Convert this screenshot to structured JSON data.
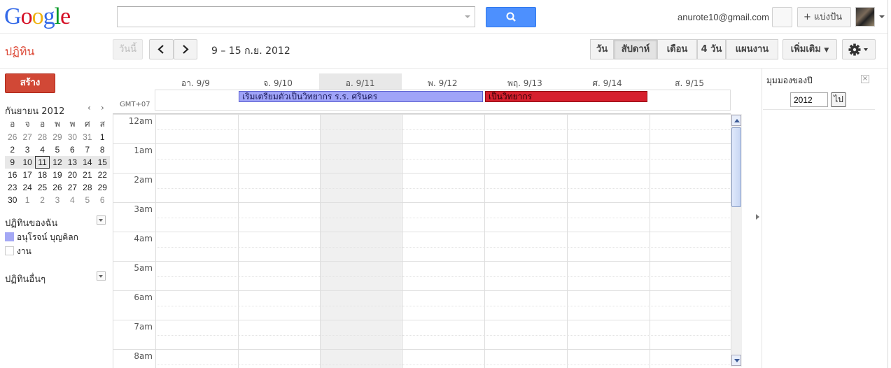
{
  "logo": {
    "letters": [
      {
        "ch": "G",
        "color": "#3369e8"
      },
      {
        "ch": "o",
        "color": "#d50f25"
      },
      {
        "ch": "o",
        "color": "#eeb211"
      },
      {
        "ch": "g",
        "color": "#3369e8"
      },
      {
        "ch": "l",
        "color": "#009925"
      },
      {
        "ch": "e",
        "color": "#d50f25"
      }
    ]
  },
  "header": {
    "email": "anurote10@gmail.com",
    "share_label": "+ แบ่งปัน"
  },
  "toolbar": {
    "title": "ปฏิทิน",
    "today_label": "วันนี้",
    "date_range": "9 – 15 ก.ย. 2012",
    "views": [
      {
        "label": "วัน",
        "active": false
      },
      {
        "label": "สัปดาห์",
        "active": true
      },
      {
        "label": "เดือน",
        "active": false
      },
      {
        "label": "4 วัน",
        "active": false
      },
      {
        "label": "แผนงาน",
        "active": false
      }
    ],
    "more_label": "เพิ่มเติม"
  },
  "sidebar": {
    "create_label": "สร้าง",
    "mini_calendar": {
      "month_label": "กันยายน 2012",
      "weekdays": [
        "อ",
        "จ",
        "อ",
        "พ",
        "พ",
        "ศ",
        "ส"
      ],
      "weeks": [
        [
          {
            "d": "26",
            "o": true
          },
          {
            "d": "27",
            "o": true
          },
          {
            "d": "28",
            "o": true
          },
          {
            "d": "29",
            "o": true
          },
          {
            "d": "30",
            "o": true
          },
          {
            "d": "31",
            "o": true
          },
          {
            "d": "1"
          }
        ],
        [
          {
            "d": "2"
          },
          {
            "d": "3"
          },
          {
            "d": "4"
          },
          {
            "d": "5"
          },
          {
            "d": "6"
          },
          {
            "d": "7"
          },
          {
            "d": "8"
          }
        ],
        [
          {
            "d": "9"
          },
          {
            "d": "10"
          },
          {
            "d": "11",
            "today": true
          },
          {
            "d": "12"
          },
          {
            "d": "13"
          },
          {
            "d": "14"
          },
          {
            "d": "15"
          }
        ],
        [
          {
            "d": "16"
          },
          {
            "d": "17"
          },
          {
            "d": "18"
          },
          {
            "d": "19"
          },
          {
            "d": "20"
          },
          {
            "d": "21"
          },
          {
            "d": "22"
          }
        ],
        [
          {
            "d": "23"
          },
          {
            "d": "24"
          },
          {
            "d": "25"
          },
          {
            "d": "26"
          },
          {
            "d": "27"
          },
          {
            "d": "28"
          },
          {
            "d": "29"
          }
        ],
        [
          {
            "d": "30"
          },
          {
            "d": "1",
            "o": true
          },
          {
            "d": "2",
            "o": true
          },
          {
            "d": "3",
            "o": true
          },
          {
            "d": "4",
            "o": true
          },
          {
            "d": "5",
            "o": true
          },
          {
            "d": "6",
            "o": true
          }
        ]
      ],
      "selected_week_index": 2
    },
    "my_calendars_title": "ปฏิทินของฉัน",
    "my_calendars": [
      {
        "name": "อนุโรจน์ บุญคิลก",
        "color": "#a4a8f5",
        "checked": true
      },
      {
        "name": "งาน",
        "color": "#ffffff",
        "checked": false
      }
    ],
    "other_calendars_title": "ปฏิทินอื่นๆ"
  },
  "grid": {
    "timezone": "GMT+07",
    "days": [
      "อา. 9/9",
      "จ. 9/10",
      "อ. 9/11",
      "พ. 9/12",
      "พฤ. 9/13",
      "ศ. 9/14",
      "ส. 9/15"
    ],
    "today_index": 2,
    "hours": [
      "12am",
      "1am",
      "2am",
      "3am",
      "4am",
      "5am",
      "6am",
      "7am",
      "8am"
    ],
    "allday_events": [
      {
        "title": "เริ่มเตรียมตัวเป็นวิทยากร ร.ร. ศรินคร",
        "bg": "#a0a4f8",
        "border": "#5a5fcf",
        "text": "#1a1a5a"
      },
      {
        "title": "เป็นวิทยากร",
        "bg": "#d6202e",
        "border": "#8e0a12",
        "text": "#2a0005"
      }
    ]
  },
  "right_panel": {
    "title": "มุมมองของปี",
    "year_value": "2012",
    "go_label": "ไป"
  }
}
